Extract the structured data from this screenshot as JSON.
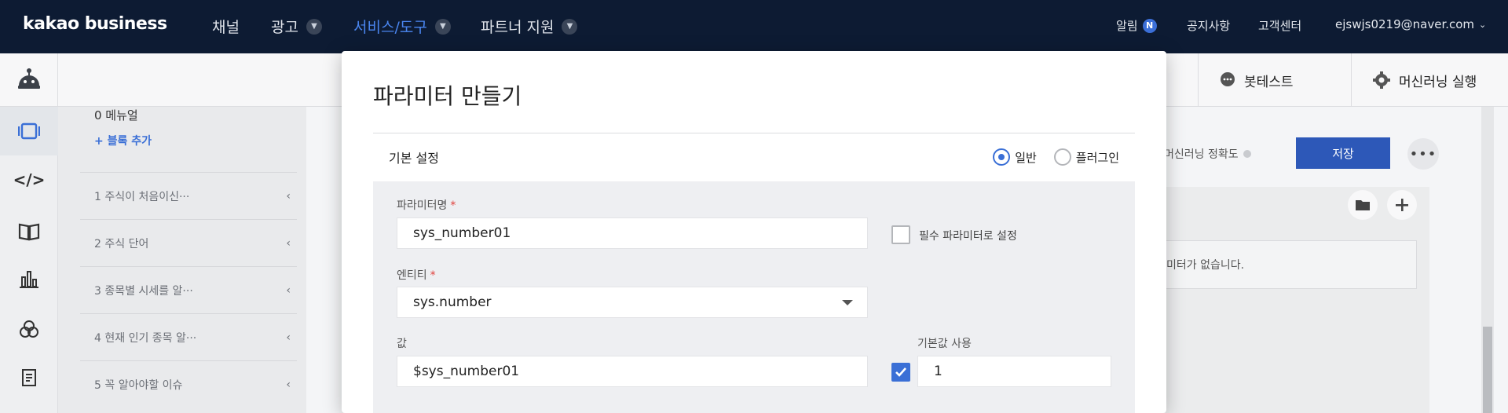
{
  "topnav": {
    "logo": "kakao business",
    "menu": [
      {
        "label": "채널",
        "has_dropdown": false,
        "active": false
      },
      {
        "label": "광고",
        "has_dropdown": true,
        "active": false
      },
      {
        "label": "서비스/도구",
        "has_dropdown": true,
        "active": true
      },
      {
        "label": "파트너 지원",
        "has_dropdown": true,
        "active": false
      }
    ],
    "alarm_label": "알림",
    "alarm_badge": "N",
    "notice_label": "공지사항",
    "support_label": "고객센터",
    "account": "ejswjs0219@naver.com"
  },
  "subbar": {
    "bot_test_label": "봇테스트",
    "ml_run_label": "머신러닝 실행"
  },
  "scenario_panel": {
    "top_text": "0 메뉴얼",
    "add_block_label": "+ 블록 추가",
    "items": [
      "1 주식이 처음이신···",
      "2 주식 단어",
      "3 종목별 시세를 알···",
      "4 현재 인기 종목 알···",
      "5 꼭 알아야할 이슈"
    ]
  },
  "main": {
    "ml_accuracy_label": "머신러닝 정확도",
    "save_label": "저장",
    "empty_text": "미터가 없습니다."
  },
  "modal": {
    "title": "파라미터 만들기",
    "section_title": "기본 설정",
    "radio_general": "일반",
    "radio_plugin": "플러그인",
    "param_name_label": "파라미터명",
    "param_name_value": "sys_number01",
    "required_checkbox_label": "필수 파라미터로 설정",
    "entity_label": "엔티티",
    "entity_value": "sys.number",
    "value_label": "값",
    "value_value": "$sys_number01",
    "default_label": "기본값 사용",
    "default_value": "1",
    "required_mark": "*"
  },
  "colors": {
    "topnav_bg": "#0d1b33",
    "accent_blue": "#3a6fd6",
    "save_button": "#2d58b8"
  }
}
